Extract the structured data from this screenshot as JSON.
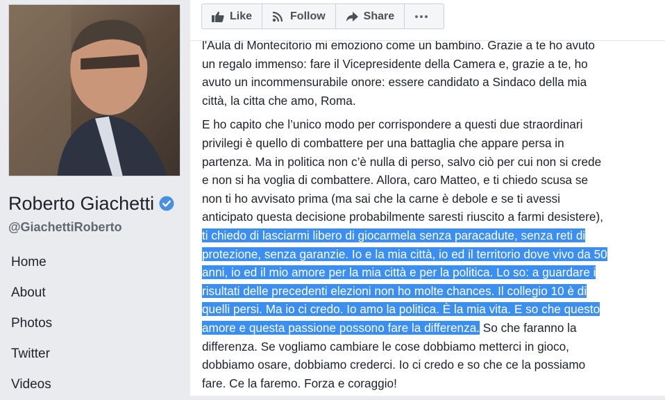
{
  "profile": {
    "name": "Roberto Giachetti",
    "handle": "@GiachettiRoberto",
    "verified_icon": "verified-badge-icon",
    "verified_color": "#4a90e2"
  },
  "nav": {
    "items": [
      {
        "label": "Home"
      },
      {
        "label": "About"
      },
      {
        "label": "Photos"
      },
      {
        "label": "Twitter"
      },
      {
        "label": "Videos"
      }
    ]
  },
  "actions": {
    "like": "Like",
    "follow": "Follow",
    "share": "Share",
    "more_icon": "ellipsis-icon"
  },
  "post": {
    "p1": [
      "l'Aula di Montecitorio mi emoziono come un bambino. Grazie a te ho avuto",
      "un regalo immenso: fare il Vicepresidente della Camera e, grazie a te, ho",
      "avuto un incommensurabile onore: essere candidato a Sindaco della mia",
      "città, la citta che amo, Roma."
    ],
    "p2": {
      "l1": "E ho capito che l’unico modo per corrispondere a questi due straordinari",
      "l2": "privilegi è quello di combattere per una battaglia che appare persa in",
      "l3": "partenza. Ma in politica non c’è nulla di perso, salvo ciò per cui non si crede",
      "l4": "e non si ha voglia di combattere. Allora, caro Matteo, e ti chiedo scusa se",
      "l5": "non ti ho avvisato prima (ma sai che la carne è debole e se ti avessi",
      "l6": "anticipato questa decisione probabilmente saresti riuscito a farmi desistere),",
      "s1": "ti chiedo di lasciarmi libero di giocarmela senza paracadute, senza reti di",
      "s2": "protezione, senza garanzie. Io e la mia città, io ed il territorio dove vivo da 50",
      "s3": "anni, io ed il mio amore per la mia città e per la politica. Lo so: a guardare i",
      "s4": "risultati delle precedenti elezioni non ho molte chances. Il collegio 10 è di",
      "s5": "quelli persi. Ma io ci credo. Io amo la politica. È la mia vita. E so che questo",
      "s6": "amore e questa passione possono fare la differenza.",
      "after_sel": " So che faranno la",
      "l7": "differenza. Se vogliamo cambiare le cose dobbiamo metterci in gioco,",
      "l8": "dobbiamo osare, dobbiamo crederci. Io ci credo e so che ce la possiamo",
      "l9": "fare. Ce la faremo. Forza e coraggio!"
    },
    "selection_color": "#3b8ef2"
  }
}
